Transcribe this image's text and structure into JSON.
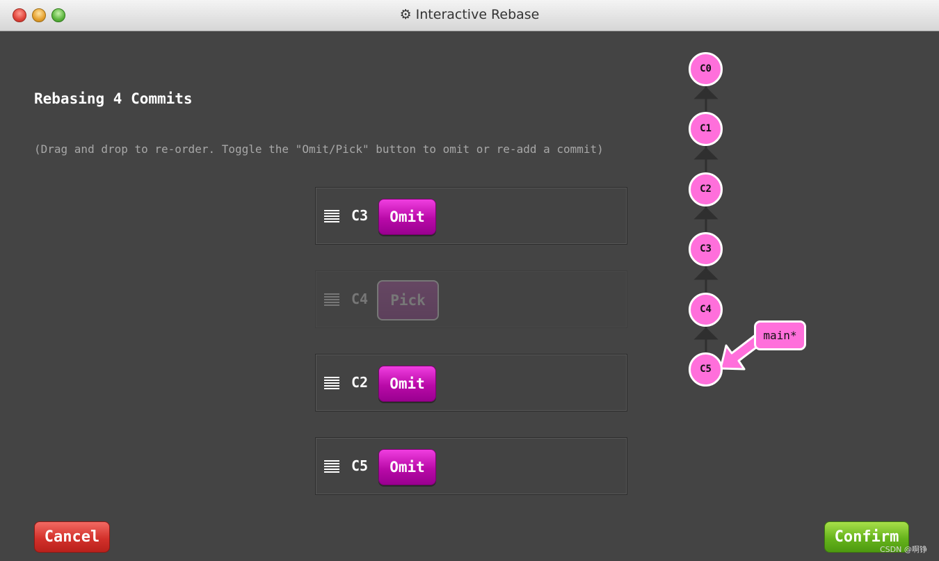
{
  "window": {
    "title": "Interactive Rebase",
    "gear_icon": "⚙"
  },
  "heading": "Rebasing 4 Commits",
  "instructions": "(Drag and drop to re-order. Toggle the \"Omit/Pick\" button to omit or re-add a commit)",
  "commits": [
    {
      "id": "C3",
      "button": "Omit",
      "state": "picked"
    },
    {
      "id": "C4",
      "button": "Pick",
      "state": "omitted"
    },
    {
      "id": "C2",
      "button": "Omit",
      "state": "picked"
    },
    {
      "id": "C5",
      "button": "Omit",
      "state": "picked"
    }
  ],
  "graph": {
    "nodes": [
      "C0",
      "C1",
      "C2",
      "C3",
      "C4",
      "C5"
    ],
    "branch": "main*",
    "colors": {
      "node": "#ff6fdb",
      "edge": "#2f2f2f"
    }
  },
  "buttons": {
    "cancel": "Cancel",
    "confirm": "Confirm"
  },
  "watermark": "CSDN @啊铮"
}
